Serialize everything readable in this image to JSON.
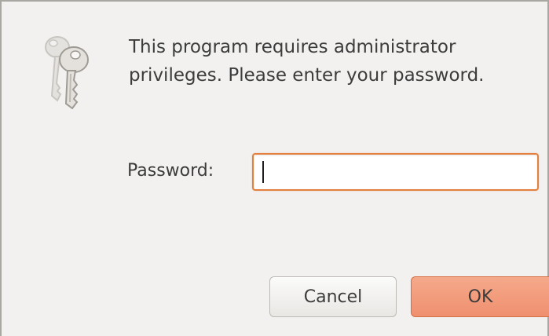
{
  "dialog": {
    "message": "This program requires administrator\nprivileges.  Please enter your password.",
    "icon": "keys-icon",
    "password_label": "Password:",
    "password_value": "",
    "cancel_label": "Cancel",
    "ok_label": "OK"
  },
  "colors": {
    "background": "#f2f1f0",
    "accent": "#e2813f",
    "ok_button": "#f0977a",
    "text": "#3c3c3c"
  }
}
